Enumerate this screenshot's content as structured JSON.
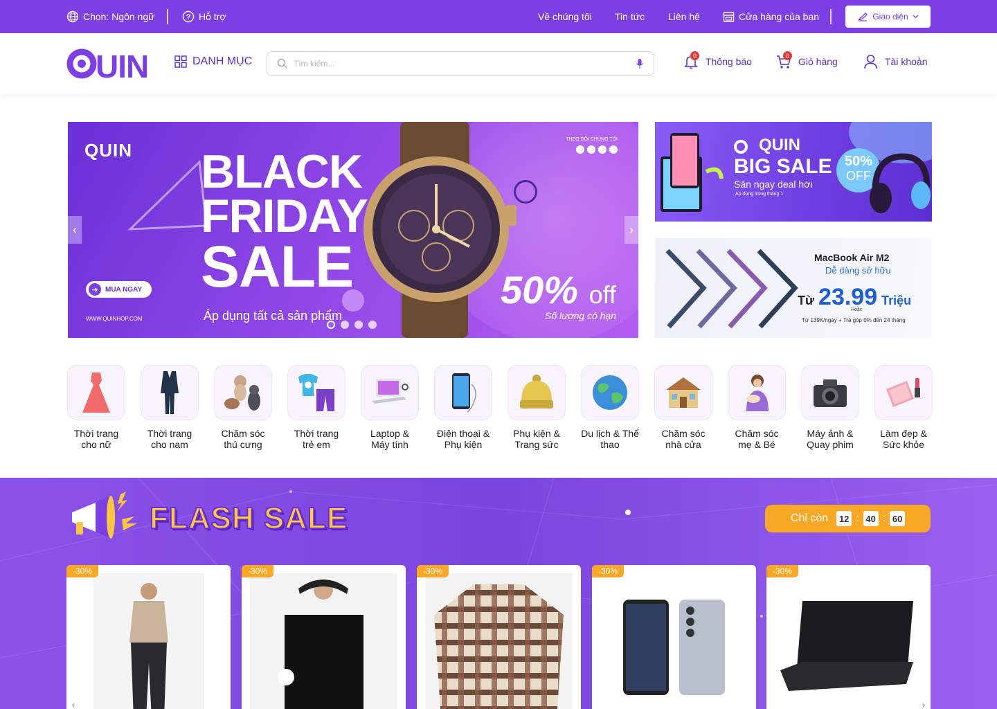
{
  "topbar": {
    "language_label": "Chọn: Ngôn ngữ",
    "support_label": "Hỗ trợ",
    "about_label": "Về chúng tôi",
    "news_label": "Tin tức",
    "contact_label": "Liên hệ",
    "store_label": "Cửa hàng của bạn",
    "theme_label": "Giao diện"
  },
  "header": {
    "logo_text": "QUIN",
    "category_label": "DANH MỤC",
    "search_placeholder": "Tìm kiếm...",
    "notifications_label": "Thông báo",
    "notifications_count": "0",
    "cart_label": "Giỏ hàng",
    "cart_count": "0",
    "account_label": "Tài khoản"
  },
  "hero": {
    "logo": "QUIN",
    "follow_label": "THEO DÕI CHÚNG TÔI",
    "title_line1": "BLACK",
    "title_line2": "FRIDAY",
    "title_line3": "SALE",
    "subtitle": "Áp dụng tất cả sản phẩm",
    "discount": "50%",
    "discount_suffix": "off",
    "limited": "Số lượng có hạn",
    "cta": "MUA NGAY",
    "url": "WWW.QUINHOP.COM",
    "slides": 4,
    "active_slide": 1
  },
  "side_banner_1": {
    "logo": "QUIN",
    "title": "BIG SALE",
    "subtitle": "Săn ngay deal hời",
    "note": "Áp dụng trong tháng 1",
    "badge_percent": "50%",
    "badge_off": "OFF"
  },
  "side_banner_2": {
    "product": "MacBook Air M2",
    "tagline": "Dễ dàng sở hữu",
    "price_prefix": "Từ",
    "price": "23.99",
    "price_unit": "Triệu",
    "or_label": "Hoặc",
    "installment": "Từ 139K/ngày + Trả góp 0% đến 24 tháng"
  },
  "categories": [
    {
      "line1": "Thời trang",
      "line2": "cho nữ",
      "icon": "dress-icon"
    },
    {
      "line1": "Thời trang",
      "line2": "cho nam",
      "icon": "suit-icon"
    },
    {
      "line1": "Chăm sóc",
      "line2": "thú cưng",
      "icon": "pets-icon"
    },
    {
      "line1": "Thời trang",
      "line2": "trẻ em",
      "icon": "kids-clothes-icon"
    },
    {
      "line1": "Laptop &",
      "line2": "Máy tính",
      "icon": "laptop-icon"
    },
    {
      "line1": "Điện thoại &",
      "line2": "Phụ kiện",
      "icon": "phone-icon"
    },
    {
      "line1": "Phụ kiện &",
      "line2": "Trang sức",
      "icon": "beanie-icon"
    },
    {
      "line1": "Du lịch & Thể",
      "line2": "thao",
      "icon": "globe-icon"
    },
    {
      "line1": "Chăm sóc",
      "line2": "nhà cửa",
      "icon": "house-icon"
    },
    {
      "line1": "Chăm sóc",
      "line2": "mẹ & Bé",
      "icon": "mother-baby-icon"
    },
    {
      "line1": "Máy ảnh &",
      "line2": "Quay phim",
      "icon": "camera-icon"
    },
    {
      "line1": "Làm đẹp &",
      "line2": "Sức khỏe",
      "icon": "makeup-icon"
    }
  ],
  "flash_sale": {
    "title": "FLASH SALE",
    "countdown_label": "Chỉ còn",
    "hours": "12",
    "minutes": "40",
    "seconds": "60",
    "products": [
      {
        "discount": "-30%",
        "image": "man-tshirt-image"
      },
      {
        "discount": "-30%",
        "image": "woman-sport-shirt-image"
      },
      {
        "discount": "-30%",
        "image": "plaid-shirt-image"
      },
      {
        "discount": "-30%",
        "image": "smartphones-image"
      },
      {
        "discount": "-30%",
        "image": "laptop-image"
      }
    ]
  },
  "colors": {
    "brand_purple": "#7b3fe4",
    "accent_orange": "#f9a825",
    "badge_red": "#e53935"
  }
}
